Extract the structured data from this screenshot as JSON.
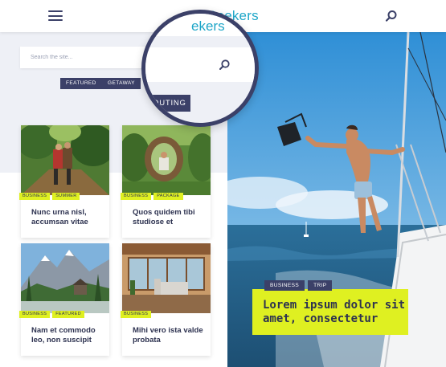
{
  "header": {
    "logo_text": "Seekers",
    "menu_icon": "hamburger-menu-icon",
    "search_icon": "search-icon"
  },
  "search": {
    "placeholder": "Search the site...",
    "value": ""
  },
  "filter_tags": [
    "FEATURED",
    "GETAWAY",
    "SCOUTING"
  ],
  "lens": {
    "visible_tag": "OUTING",
    "visible_logo_text": "ekers"
  },
  "cards": [
    {
      "tags": [
        "BUSINESS",
        "SUMMER"
      ],
      "title": "Nunc urna nisl, accumsan vitae"
    },
    {
      "tags": [
        "BUSINESS",
        "PACKAGE"
      ],
      "title": "Quos quidem tibi studiose et"
    },
    {
      "tags": [
        "BUSINESS",
        "FEATURED"
      ],
      "title": "Nam et commodo leo, non suscipit"
    },
    {
      "tags": [
        "BUSINESS"
      ],
      "title": "Mihi vero ista valde probata"
    }
  ],
  "hero": {
    "tags": [
      "BUSINESS",
      "TRIP"
    ],
    "title": "Lorem ipsum dolor sit amet, consectetur"
  },
  "colors": {
    "navy": "#3b4068",
    "accent_yellow": "#dff021",
    "logo_blue": "#1ea6c8",
    "panel_bg": "#eef0f6"
  }
}
